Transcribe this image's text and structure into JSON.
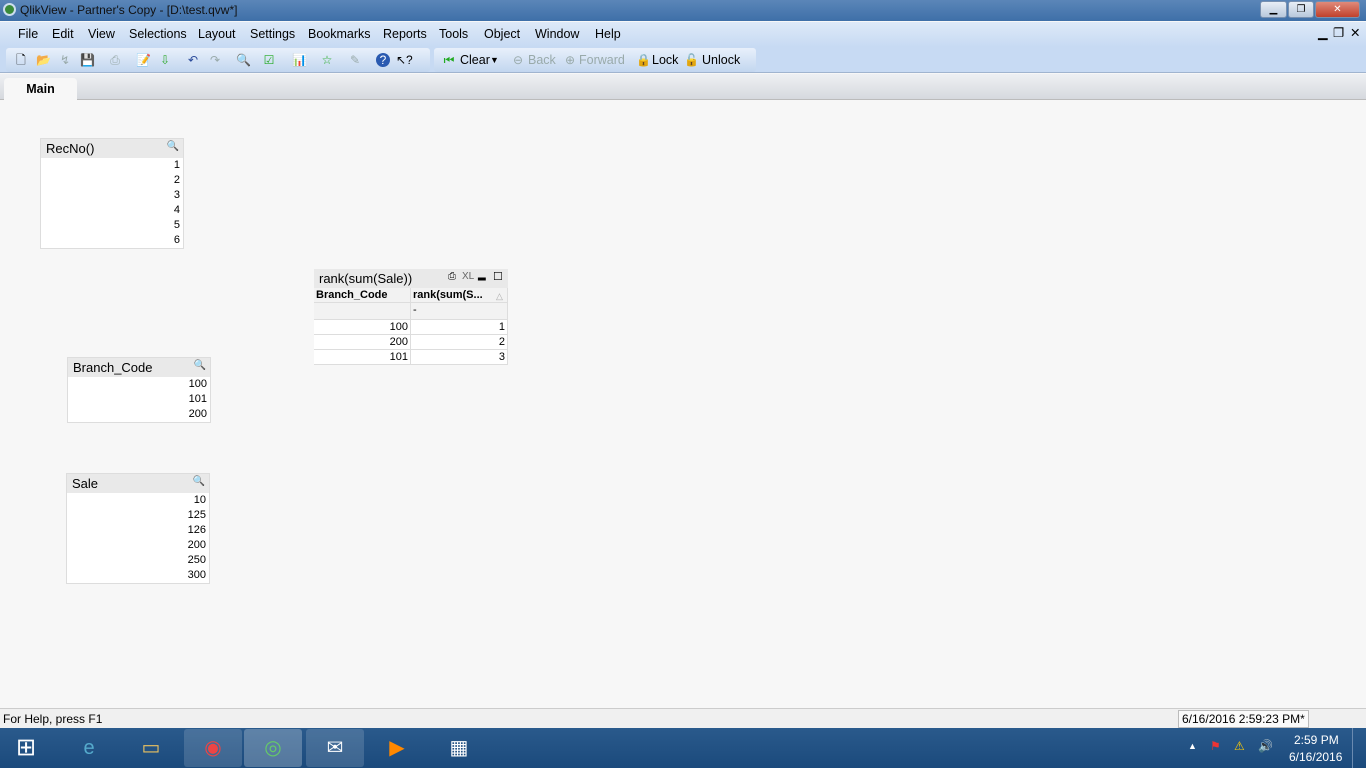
{
  "window": {
    "title": "QlikView - Partner's Copy - [D:\\test.qvw*]"
  },
  "menu": [
    "File",
    "Edit",
    "View",
    "Selections",
    "Layout",
    "Settings",
    "Bookmarks",
    "Reports",
    "Tools",
    "Object",
    "Window",
    "Help"
  ],
  "toolbar": {
    "clear": "Clear",
    "back": "Back",
    "forward": "Forward",
    "lock": "Lock",
    "unlock": "Unlock"
  },
  "tabs": [
    {
      "label": "Main",
      "active": true
    }
  ],
  "listboxes": {
    "recno": {
      "title": "RecNo()",
      "values": [
        "1",
        "2",
        "3",
        "4",
        "5",
        "6"
      ]
    },
    "branch": {
      "title": "Branch_Code",
      "values": [
        "100",
        "101",
        "200"
      ]
    },
    "sale": {
      "title": "Sale",
      "values": [
        "10",
        "125",
        "126",
        "200",
        "250",
        "300"
      ]
    }
  },
  "table": {
    "title": "rank(sum(Sale))",
    "xl": "XL",
    "headers": [
      "Branch_Code",
      "rank(sum(S..."
    ],
    "total": "-",
    "rows": [
      [
        "100",
        "1"
      ],
      [
        "200",
        "2"
      ],
      [
        "101",
        "3"
      ]
    ]
  },
  "status": {
    "help": "For Help, press F1",
    "timestamp": "6/16/2016 2:59:23 PM*"
  },
  "taskbar": {
    "time": "2:59 PM",
    "date": "6/16/2016"
  }
}
